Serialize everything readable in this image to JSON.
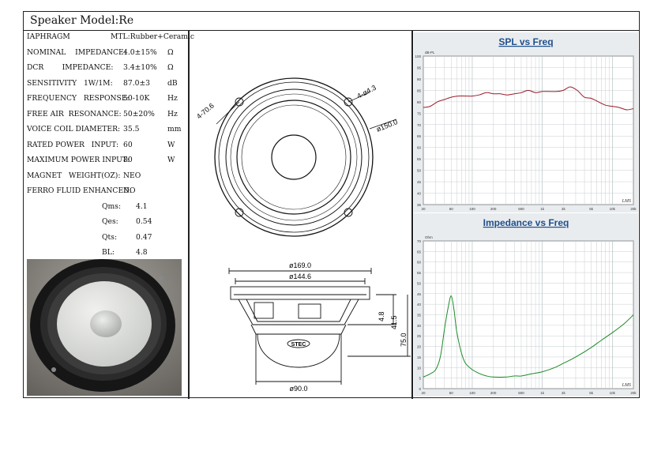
{
  "title": "Speaker Model:Re",
  "specs": [
    {
      "label": "IAPHRAGM",
      "value": "MTL:Rubber+Ceramic",
      "unit": ""
    },
    {
      "label": "NOMINAL    IMPEDANCE:",
      "value": "4.0±15%",
      "unit": "Ω"
    },
    {
      "label": "DCR        IMPEDANCE:",
      "value": "3.4±10%",
      "unit": "Ω"
    },
    {
      "label": "SENSITIVITY   1W/1M:",
      "value": "87.0±3",
      "unit": "dB"
    },
    {
      "label": "FREQUENCY   RESPONSE:",
      "value": "50-10K",
      "unit": "Hz"
    },
    {
      "label": "FREE AIR  RESONANCE:",
      "value": "50±20%",
      "unit": "Hz"
    },
    {
      "label": "VOICE COIL DIAMETER:",
      "value": "35.5",
      "unit": "mm"
    },
    {
      "label": "RATED POWER   INPUT:",
      "value": "60",
      "unit": "W"
    },
    {
      "label": "MAXIMUM POWER INPUT:",
      "value": "80",
      "unit": "W"
    },
    {
      "label": "MAGNET   WEIGHT(OZ):",
      "value": "NEO",
      "unit": ""
    },
    {
      "label": "FERRO FLUID ENHANCED:",
      "value": "NO",
      "unit": ""
    }
  ],
  "params": [
    {
      "label": "Qms:",
      "value": "4.1"
    },
    {
      "label": "Qes:",
      "value": "0.54"
    },
    {
      "label": "Qts:",
      "value": "0.47"
    },
    {
      "label": "BL:",
      "value": "4.8"
    }
  ],
  "drawing": {
    "dim_holes_left": "4-70.6",
    "dim_holes_right": "4-ø4.3",
    "dim_bolt_circle": "ø150.0",
    "dim_outer": "ø169.0",
    "dim_cutout": "ø144.6",
    "dim_flange": "4.8",
    "dim_mount_depth": "41.5",
    "dim_total_depth": "75.0",
    "dim_magnet": "ø90.0",
    "brand": "STEC"
  },
  "chart_data": [
    {
      "type": "line",
      "title": "SPL vs Freq",
      "ylabel": "dB-PL",
      "yticks": [
        "100",
        "95",
        "90",
        "85",
        "80",
        "75",
        "70",
        "65",
        "60",
        "55",
        "50",
        "45",
        "40",
        "35"
      ],
      "xticks": [
        "20",
        "50",
        "100",
        "200",
        "500",
        "1k",
        "2k",
        "5k",
        "10k",
        "20k"
      ],
      "corner_label": "LMS",
      "x": [
        20,
        25,
        32,
        40,
        50,
        63,
        80,
        100,
        125,
        160,
        200,
        250,
        315,
        400,
        500,
        630,
        800,
        1000,
        1250,
        1600,
        2000,
        2500,
        3150,
        4000,
        5000,
        6300,
        8000,
        10000,
        12500,
        16000,
        20000
      ],
      "values": [
        77.5,
        78,
        80,
        81,
        82,
        82.5,
        82.5,
        82.5,
        83,
        84,
        83.5,
        83.5,
        83,
        83.5,
        84,
        85,
        84,
        84.5,
        84.5,
        84.5,
        85,
        86.5,
        85,
        82,
        81.5,
        80,
        78.5,
        78,
        77.5,
        76.5,
        77
      ],
      "color": "#9b1b2a"
    },
    {
      "type": "line",
      "title": "Impedance vs Freq",
      "ylabel": "Ohm",
      "yticks": [
        "70",
        "65",
        "60",
        "55",
        "50",
        "45",
        "40",
        "35",
        "30",
        "25",
        "20",
        "15",
        "10",
        "5",
        "0"
      ],
      "xticks": [
        "20",
        "50",
        "100",
        "200",
        "500",
        "1k",
        "2k",
        "5k",
        "10k",
        "20k"
      ],
      "corner_label": "LMS",
      "x": [
        20,
        25,
        30,
        35,
        40,
        45,
        50,
        55,
        60,
        70,
        80,
        100,
        130,
        160,
        200,
        300,
        400,
        500,
        700,
        1000,
        1500,
        2000,
        3000,
        5000,
        7000,
        10000,
        15000,
        20000
      ],
      "values": [
        5.5,
        7,
        9,
        15,
        28,
        38,
        44,
        37,
        27,
        17,
        12,
        9,
        7,
        6,
        5.5,
        5.5,
        6,
        6,
        7,
        8,
        10,
        12,
        15,
        19.5,
        23,
        26.5,
        31,
        35
      ],
      "color": "#1f8a2a"
    }
  ]
}
